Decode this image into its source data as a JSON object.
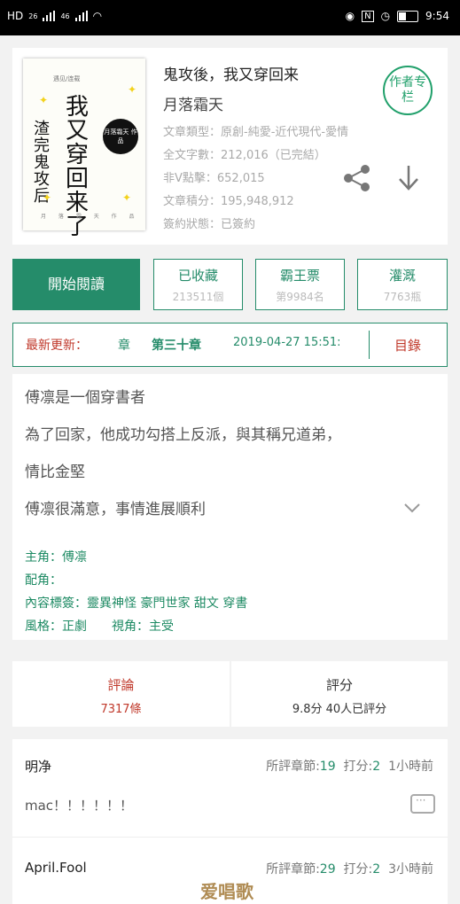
{
  "status": {
    "left": "HD",
    "sig1": "26",
    "sig2": "46",
    "time": "9:54",
    "icons": [
      "eye-icon",
      "nfc-icon",
      "alarm-icon",
      "battery-icon"
    ]
  },
  "book": {
    "cover": {
      "small": "遇见/连载",
      "title_big": "我又穿回来了",
      "title_side": "渣完鬼攻后",
      "circle": "月落霜天 作品",
      "bottom": "月 落 霜 天 作 品"
    },
    "title": "鬼攻後，我又穿回来",
    "author": "月落霜天",
    "meta": [
      "文章類型：原創-純愛-近代現代-愛情",
      "全文字數：212,016（已完結）",
      "非V點擊：652,015",
      "文章積分：195,948,912",
      "簽約狀態：已簽約"
    ],
    "badge": "作者专栏"
  },
  "actions": {
    "read": "開始閱讀",
    "stats": [
      {
        "label": "已收藏",
        "value": "213511個"
      },
      {
        "label": "霸王票",
        "value": "第9984名"
      },
      {
        "label": "灌溉",
        "value": "7763瓶"
      }
    ]
  },
  "update": {
    "label": "最新更新：",
    "kind": "章",
    "chapter": "第三十章",
    "date": "2019-04-27  15:51:",
    "toc": "目錄"
  },
  "description": {
    "lines": [
      "傅凛是一個穿書者",
      "為了回家，他成功勾搭上反派，與其稱兄道弟，",
      "情比金堅",
      "傅凛很滿意，事情進展順利"
    ],
    "tags": [
      "主角：傅凛",
      "配角：",
      "內容標簽：靈異神怪 豪門世家 甜文 穿書",
      "風格：正劇　　視角：主受"
    ]
  },
  "ratings": {
    "comments_label": "評論",
    "comments_count": "7317條",
    "score_label": "評分",
    "score_value": "9.8分  40人已評分"
  },
  "comments": [
    {
      "name": "明净",
      "chapter_label": "所評章節:",
      "chapter": "19",
      "score_label": "打分:",
      "score": "2",
      "time": "1小時前",
      "text": "mac！！！！！！"
    },
    {
      "name": "April.Fool",
      "chapter_label": "所評章節:",
      "chapter": "29",
      "score_label": "打分:",
      "score": "2",
      "time": "3小時前",
      "text": ""
    }
  ],
  "watermark": "爱唱歌",
  "colors": {
    "accent": "#258c6a",
    "red": "#c0392b"
  }
}
